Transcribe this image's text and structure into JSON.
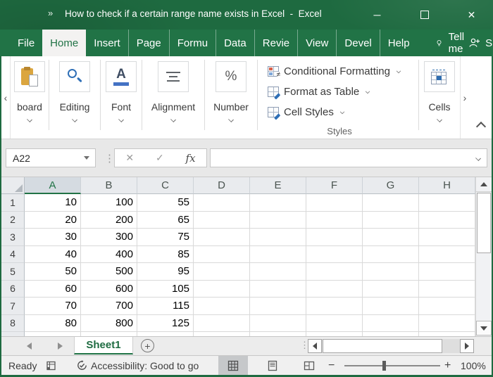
{
  "titlebar": {
    "quick_access": "»",
    "title": "How to check if a certain range name exists in Excel  -  Excel",
    "minimize_glyph": "─",
    "close_glyph": "✕"
  },
  "ribbon_tabs": {
    "tabs": [
      {
        "label": "File",
        "active": false
      },
      {
        "label": "Home",
        "active": true
      },
      {
        "label": "Insert",
        "active": false
      },
      {
        "label": "Page",
        "active": false
      },
      {
        "label": "Formu",
        "active": false
      },
      {
        "label": "Data",
        "active": false
      },
      {
        "label": "Revie",
        "active": false
      },
      {
        "label": "View",
        "active": false
      },
      {
        "label": "Devel",
        "active": false
      },
      {
        "label": "Help",
        "active": false
      }
    ],
    "tell_me_label": "Tell me",
    "share_label": "Share"
  },
  "ribbon": {
    "scroll_left_glyph": "‹",
    "scroll_right_glyph": "›",
    "groups": [
      {
        "label": "board",
        "icon": "clipboard-icon"
      },
      {
        "label": "Editing",
        "icon": "search-icon"
      },
      {
        "label": "Font",
        "icon": "font-underline-icon"
      },
      {
        "label": "Alignment",
        "icon": "align-center-icon"
      },
      {
        "label": "Number",
        "icon": "percent-icon"
      }
    ],
    "font_glyph": "A",
    "percent_glyph": "%",
    "styles": {
      "items": [
        {
          "label": "Conditional Formatting",
          "icon": "conditional-formatting-icon"
        },
        {
          "label": "Format as Table",
          "icon": "format-as-table-icon"
        },
        {
          "label": "Cell Styles",
          "icon": "cell-styles-icon"
        }
      ],
      "group_label": "Styles"
    },
    "cells": {
      "label": "Cells",
      "icon": "cells-icon"
    }
  },
  "formula_bar": {
    "name_box_value": "A22",
    "drag_dots_glyph": "⋮",
    "cancel_glyph": "✕",
    "enter_glyph": "✓",
    "insert_function_glyph": "fx",
    "formula_value": ""
  },
  "grid": {
    "columns": [
      "A",
      "B",
      "C",
      "D",
      "E",
      "F",
      "G",
      "H"
    ],
    "selected_column": "A",
    "rows": [
      {
        "num": "1",
        "values": [
          "10",
          "100",
          "55"
        ]
      },
      {
        "num": "2",
        "values": [
          "20",
          "200",
          "65"
        ]
      },
      {
        "num": "3",
        "values": [
          "30",
          "300",
          "75"
        ]
      },
      {
        "num": "4",
        "values": [
          "40",
          "400",
          "85"
        ]
      },
      {
        "num": "5",
        "values": [
          "50",
          "500",
          "95"
        ]
      },
      {
        "num": "6",
        "values": [
          "60",
          "600",
          "105"
        ]
      },
      {
        "num": "7",
        "values": [
          "70",
          "700",
          "115"
        ]
      },
      {
        "num": "8",
        "values": [
          "80",
          "800",
          "125"
        ]
      }
    ]
  },
  "sheet_bar": {
    "active_tab_label": "Sheet1",
    "add_sheet_glyph": "+",
    "drag_dots_glyph": "⋮"
  },
  "status_bar": {
    "mode_label": "Ready",
    "accessibility_label": "Accessibility: Good to go",
    "zoom_out_glyph": "−",
    "zoom_in_glyph": "+",
    "zoom_level": "100%"
  },
  "colors": {
    "excel_green": "#217346",
    "title_bar_green": "#1e6a40",
    "icon_blue": "#2f6fb6",
    "selected_header_bg": "#d5dbe1",
    "grid_line": "#d9d9d9"
  }
}
